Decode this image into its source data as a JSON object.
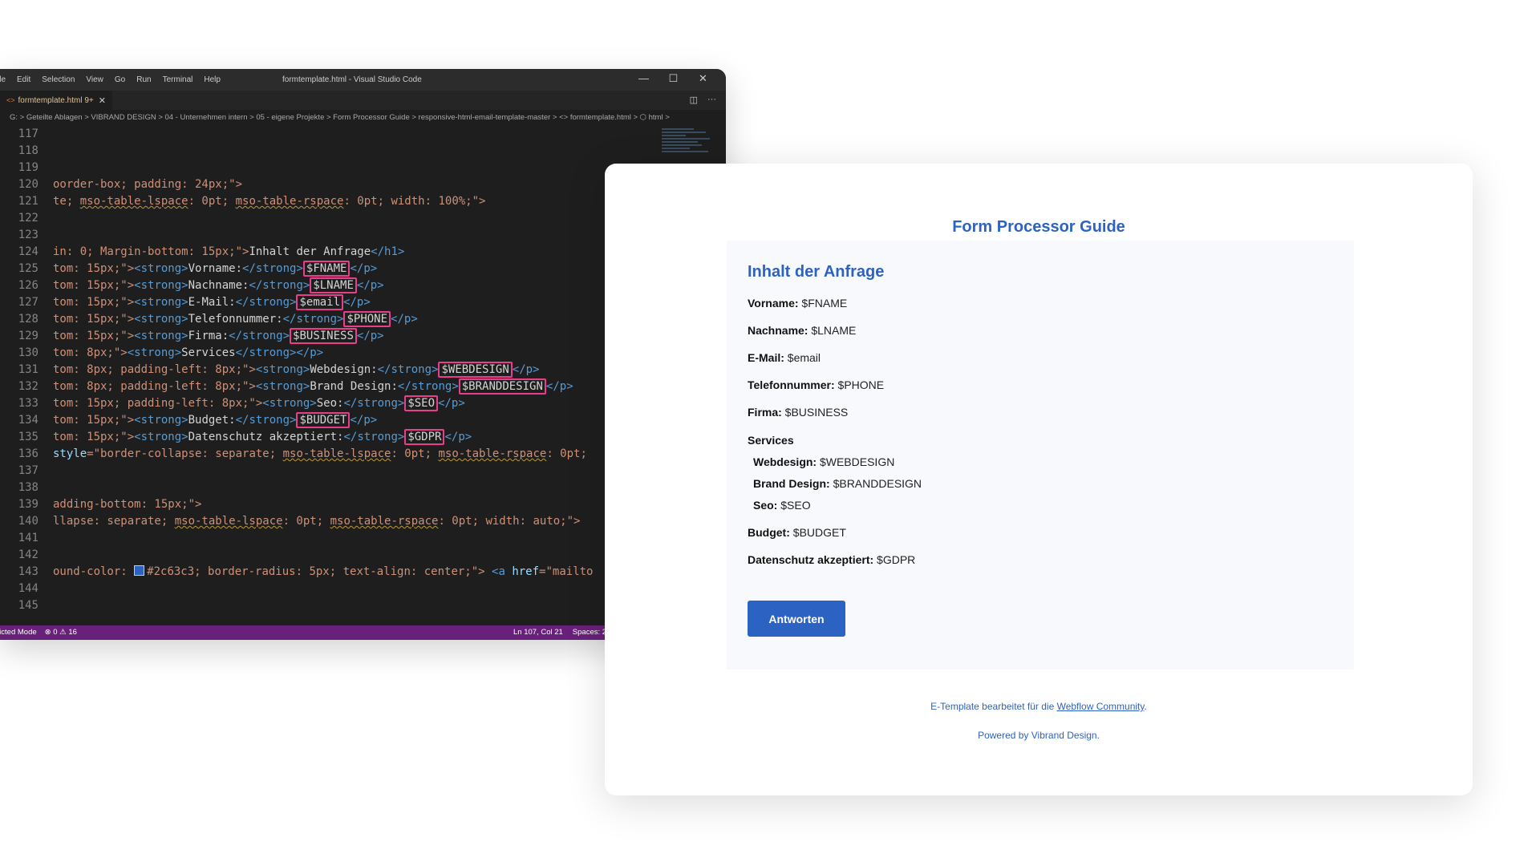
{
  "vscode": {
    "menu": [
      "ile",
      "Edit",
      "Selection",
      "View",
      "Go",
      "Run",
      "Terminal",
      "Help"
    ],
    "window_title": "formtemplate.html - Visual Studio Code",
    "controls": {
      "minimize": "—",
      "maximize": "☐",
      "close": "✕"
    },
    "tab": {
      "icon": "<>",
      "label": "formtemplate.html 9+",
      "close": "✕"
    },
    "tab_actions": {
      "split": "◫",
      "more": "···"
    },
    "breadcrumb": "G: > Geteilte Ablagen > VIBRAND DESIGN > 04 - Unternehmen intern > 05 - eigene Projekte > Form Processor Guide > responsive-html-email-template-master > <> formtemplate.html > ⬡ html >",
    "lines": {
      "l117": "117",
      "l118": "118",
      "l119": "119",
      "l120": "120",
      "l121": "121",
      "l122": "122",
      "l123": "123",
      "l124": "124",
      "l125": "125",
      "l126": "126",
      "l127": "127",
      "l128": "128",
      "l129": "129",
      "l130": "130",
      "l131": "131",
      "l132": "132",
      "l133": "133",
      "l134": "134",
      "l135": "135",
      "l136": "136",
      "l137": "137",
      "l138": "138",
      "l139": "139",
      "l140": "140",
      "l141": "141",
      "l142": "142",
      "l143": "143",
      "l144": "144",
      "l145": "145"
    },
    "code": {
      "c120": "oorder-box; padding: 24px;\">",
      "c121a": "te; ",
      "c121b": "mso-table-lspace",
      "c121c": ": 0pt; ",
      "c121d": "mso-table-rspace",
      "c121e": ": 0pt; width: 100%;\">",
      "c124a": "in: 0; Margin-bottom: 15px;\">",
      "c124b": "Inhalt der Anfrage",
      "c124c": "</h1>",
      "c125a": "tom: 15px;\">",
      "c125b": "<strong>",
      "c125c": "Vorname:",
      "c125d": "</strong>",
      "c125e": "$FNAME",
      "c125f": "</p>",
      "c126a": "tom: 15px;\">",
      "c126c": "Nachname:",
      "c126e": "$LNAME",
      "c127a": "tom: 15px;\">",
      "c127c": "E-Mail:",
      "c127e": "$email",
      "c128a": "tom: 15px;\">",
      "c128c": "Telefonnummer:",
      "c128e": "$PHONE",
      "c129a": "tom: 15px;\">",
      "c129c": "Firma:",
      "c129e": "$BUSINESS",
      "c130a": "tom: 8px;\">",
      "c130c": "Services",
      "c131a": "tom: 8px; padding-left: 8px;\">",
      "c131c": "Webdesign:",
      "c131e": "$WEBDESIGN",
      "c132a": "tom: 8px; padding-left: 8px;\">",
      "c132c": "Brand Design:",
      "c132e": "$BRANDDESIGN",
      "c133a": "tom: 15px; padding-left: 8px;\">",
      "c133c": "Seo:",
      "c133e": "$SEO",
      "c134a": "tom: 15px;\">",
      "c134c": "Budget:",
      "c134e": "$BUDGET",
      "c135a": "tom: 15px;\">",
      "c135c": "Datenschutz akzeptiert:",
      "c135e": "$GDPR",
      "c136a": "style",
      "c136b": "=\"border-collapse: separate; ",
      "c136c": "mso-table-lspace",
      "c136d": ": 0pt; ",
      "c136e": "mso-table-rspace",
      "c136f": ": 0pt;",
      "c139": "adding-bottom: 15px;\">",
      "c140a": "llapse: separate; ",
      "c140b": "mso-table-lspace",
      "c140c": ": 0pt; ",
      "c140d": "mso-table-rspace",
      "c140e": ": 0pt; width: auto;\">",
      "c143a": "ound-color: ",
      "c143b": "#2c63c3; border-radius: 5px; text-align: center;\"> ",
      "c143c": "<a ",
      "c143d": "href",
      "c143e": "=\"mailto"
    },
    "status": {
      "mode": "ricted Mode",
      "problems": "⊗ 0 ⚠ 16",
      "position": "Ln 107, Col 21",
      "spaces": "Spaces: 2"
    }
  },
  "email": {
    "header": "Form Processor Guide",
    "section_title": "Inhalt der Anfrage",
    "fields": {
      "vorname_label": "Vorname:",
      "vorname_value": " $FNAME",
      "nachname_label": "Nachname:",
      "nachname_value": " $LNAME",
      "email_label": "E-Mail:",
      "email_value": " $email",
      "telefon_label": "Telefonnummer:",
      "telefon_value": " $PHONE",
      "firma_label": "Firma:",
      "firma_value": " $BUSINESS",
      "services_label": "Services",
      "webdesign_label": "Webdesign:",
      "webdesign_value": " $WEBDESIGN",
      "brand_label": "Brand Design:",
      "brand_value": " $BRANDDESIGN",
      "seo_label": "Seo:",
      "seo_value": " $SEO",
      "budget_label": "Budget:",
      "budget_value": " $BUDGET",
      "gdpr_label": "Datenschutz akzeptiert:",
      "gdpr_value": " $GDPR"
    },
    "button_label": "Antworten",
    "footer_prefix": "E-Template bearbeitet für die ",
    "footer_link": "Webflow Community",
    "footer_suffix": ".",
    "powered_by": "Powered by Vibrand Design."
  }
}
